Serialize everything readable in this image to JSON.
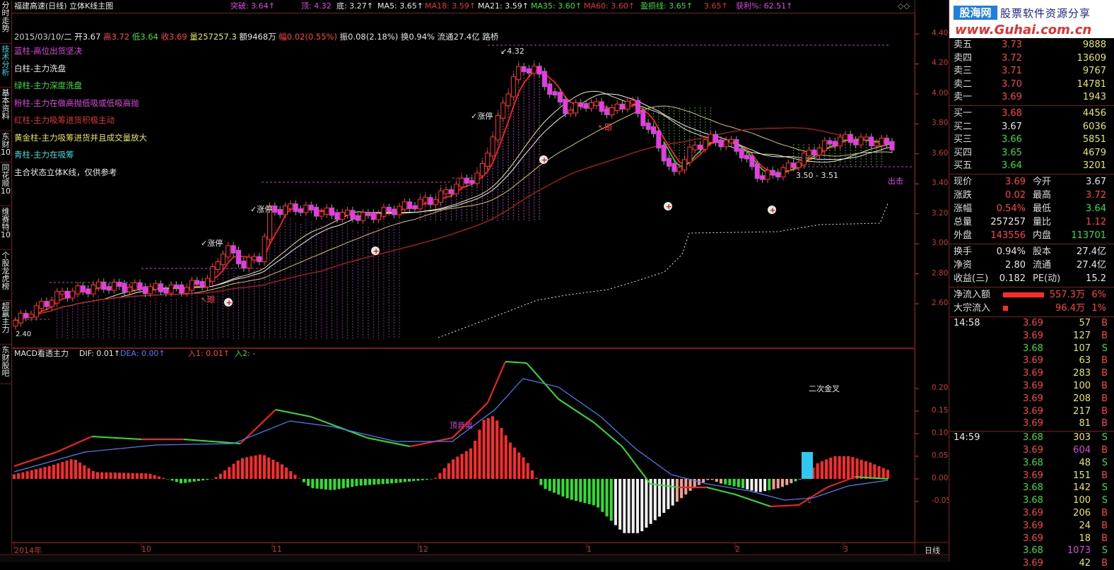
{
  "left_tabs": [
    {
      "label": "分时走势",
      "active": false
    },
    {
      "label": "技术分析",
      "active": true
    },
    {
      "label": "基本资料",
      "active": false
    },
    {
      "label": "东财10",
      "active": false
    },
    {
      "label": "同花顺10",
      "active": false
    },
    {
      "label": "维赛特10",
      "active": false
    },
    {
      "label": "个股龙虎榜",
      "active": false
    },
    {
      "label": "超赢主力",
      "active": false
    },
    {
      "label": "东财股吧",
      "active": false
    }
  ],
  "header": {
    "title": "福建高速(日线) 立体K线主图",
    "items": [
      {
        "text": "突破: 3.64↑",
        "color": "#e040e0"
      },
      {
        "text": "顶: 4.32",
        "color": "#e040e0"
      },
      {
        "text": "底: 3.27↑",
        "color": "#e8e8e8"
      },
      {
        "text": "MA5: 3.65↑",
        "color": "#e8e8e8"
      },
      {
        "text": "MA18: 3.59↑",
        "color": "#e03030"
      },
      {
        "text": "MA21: 3.59↑",
        "color": "#e8e8e8"
      },
      {
        "text": "MA35: 3.60↑",
        "color": "#30e030"
      },
      {
        "text": "MA60: 3.60↑",
        "color": "#e03030"
      },
      {
        "text": "盈损线: 3.65↑",
        "color": "#30e030"
      },
      {
        "text": "3.65↑",
        "color": "#e03030"
      },
      {
        "text": "获利%: 62.51↑",
        "color": "#e040e0"
      }
    ]
  },
  "info_line": {
    "date": "2015/03/10/二",
    "open": "开3.67",
    "high": "高3.72",
    "low": "低3.64",
    "close": "收3.69",
    "vol": "量257257.3",
    "amt": "额9468万",
    "chg": "幅0.02(0.55%)",
    "amp": "振0.08(2.18%)",
    "turn": "换0.94%",
    "float": "流通27.4亿",
    "tag": "路桥"
  },
  "legend": [
    {
      "text": "蓝柱-高位出货坚决",
      "color": "#e040e0"
    },
    {
      "text": "白柱-主力洗盘",
      "color": "#e8e8e8"
    },
    {
      "text": "绿柱-主力深度洗盘",
      "color": "#30e030"
    },
    {
      "text": "粉柱-主力在做高抛低吸或低吸高抛",
      "color": "#e040e0"
    },
    {
      "text": "红柱-主力吸筹进货积极主动",
      "color": "#e03030"
    },
    {
      "text": "黄金柱-主力吸筹进货并且成交量放大",
      "color": "#e8e850"
    },
    {
      "text": "青柱-主力在吸筹",
      "color": "#30e0e0"
    },
    {
      "text": "主合状态立体K线，仅供参考",
      "color": "#e8e8e8"
    }
  ],
  "price_axis": [
    "4.40",
    "4.20",
    "4.00",
    "3.80",
    "3.60",
    "3.40",
    "3.20",
    "3.00",
    "2.80",
    "2.60"
  ],
  "annotations": {
    "top_price": "4.32",
    "bottom_range": "3.50 - 3.51",
    "exit": "出击",
    "zt1": "涨停",
    "zt2": "涨停",
    "zt3": "涨停",
    "follow": "跟",
    "follow2": "跟",
    "left_low": "2.40"
  },
  "macd": {
    "title": "MACD看透主力",
    "dif": "DIF: 0.01↑",
    "dea": "DEA: 0.00↑",
    "in1": "入1: 0.01↑",
    "in2": "入2: -",
    "note1": "顶背离",
    "note2": "二次金叉",
    "axis": [
      "0.20",
      "0.15",
      "0.10",
      "0.05",
      "0.00",
      "-0.05"
    ]
  },
  "x_axis": [
    "2014年",
    "10",
    "11",
    "12",
    "1",
    "2",
    "3"
  ],
  "period_label": "日线",
  "right_panel": {
    "logo_top": "股海网",
    "logo_text": "股票软件资源分享",
    "logo_url": "www.Guhai.com.cn",
    "sells": [
      {
        "label": "卖五",
        "price": "3.73",
        "vol": "9888"
      },
      {
        "label": "卖四",
        "price": "3.72",
        "vol": "13609"
      },
      {
        "label": "卖三",
        "price": "3.71",
        "vol": "9767"
      },
      {
        "label": "卖二",
        "price": "3.70",
        "vol": "14781"
      },
      {
        "label": "卖一",
        "price": "3.69",
        "vol": "1943"
      }
    ],
    "buys": [
      {
        "label": "买一",
        "price": "3.68",
        "vol": "4456"
      },
      {
        "label": "买二",
        "price": "3.67",
        "vol": "6036"
      },
      {
        "label": "买三",
        "price": "3.66",
        "vol": "5851"
      },
      {
        "label": "买四",
        "price": "3.65",
        "vol": "4679"
      },
      {
        "label": "买五",
        "price": "3.64",
        "vol": "3201"
      }
    ],
    "stats": [
      {
        "l1": "现价",
        "v1": "3.69",
        "l2": "今开",
        "v2": "3.67",
        "c1": "#ff4040",
        "c2": "#e8e8e8"
      },
      {
        "l1": "涨跌",
        "v1": "0.02",
        "l2": "最高",
        "v2": "3.72",
        "c1": "#ff4040",
        "c2": "#ff4040"
      },
      {
        "l1": "涨幅",
        "v1": "0.54%",
        "l2": "最低",
        "v2": "3.64",
        "c1": "#ff4040",
        "c2": "#30e030"
      },
      {
        "l1": "总量",
        "v1": "257257",
        "l2": "量比",
        "v2": "1.12",
        "c1": "#e8e8e8",
        "c2": "#ff4040"
      },
      {
        "l1": "外盘",
        "v1": "143556",
        "l2": "内盘",
        "v2": "113701",
        "c1": "#ff4040",
        "c2": "#30e030"
      }
    ],
    "stats2": [
      {
        "l1": "换手",
        "v1": "0.94%",
        "l2": "股本",
        "v2": "27.4亿"
      },
      {
        "l1": "净资",
        "v1": "2.80",
        "l2": "流通",
        "v2": "27.4亿"
      },
      {
        "l1": "收益(三)",
        "v1": "0.182",
        "l2": "PE(动)",
        "v2": "15.2"
      }
    ],
    "flows": [
      {
        "label": "净流入额",
        "value": "557.3万",
        "pct": "6%",
        "bar": 0.85
      },
      {
        "label": "大宗流入",
        "value": "96.4万",
        "pct": "1%",
        "bar": 0.1
      }
    ],
    "ticks": [
      {
        "time": "14:58",
        "price": "3.69",
        "vol": "57",
        "side": "B"
      },
      {
        "time": "",
        "price": "3.69",
        "vol": "127",
        "side": "B"
      },
      {
        "time": "",
        "price": "3.68",
        "vol": "107",
        "side": "S"
      },
      {
        "time": "",
        "price": "3.69",
        "vol": "63",
        "side": "B"
      },
      {
        "time": "",
        "price": "3.69",
        "vol": "283",
        "side": "B"
      },
      {
        "time": "",
        "price": "3.69",
        "vol": "100",
        "side": "B"
      },
      {
        "time": "",
        "price": "3.69",
        "vol": "208",
        "side": "B"
      },
      {
        "time": "",
        "price": "3.69",
        "vol": "217",
        "side": "B"
      },
      {
        "time": "",
        "price": "3.69",
        "vol": "81",
        "side": "B"
      },
      {
        "time": "14:59",
        "price": "3.68",
        "vol": "303",
        "side": "S"
      },
      {
        "time": "",
        "price": "3.69",
        "vol": "604",
        "side": "B"
      },
      {
        "time": "",
        "price": "3.68",
        "vol": "48",
        "side": "S"
      },
      {
        "time": "",
        "price": "3.69",
        "vol": "151",
        "side": "B"
      },
      {
        "time": "",
        "price": "3.68",
        "vol": "142",
        "side": "S"
      },
      {
        "time": "",
        "price": "3.68",
        "vol": "100",
        "side": "S"
      },
      {
        "time": "",
        "price": "3.69",
        "vol": "206",
        "side": "B"
      },
      {
        "time": "",
        "price": "3.69",
        "vol": "24",
        "side": "B"
      },
      {
        "time": "",
        "price": "3.69",
        "vol": "18",
        "side": "B"
      },
      {
        "time": "",
        "price": "3.68",
        "vol": "1073",
        "side": "S"
      },
      {
        "time": "",
        "price": "3.69",
        "vol": "42",
        "side": "B"
      }
    ]
  },
  "colors": {
    "up": "#ff3030",
    "down": "#30e030",
    "frame": "#7a1818",
    "magenta": "#e040e0"
  }
}
